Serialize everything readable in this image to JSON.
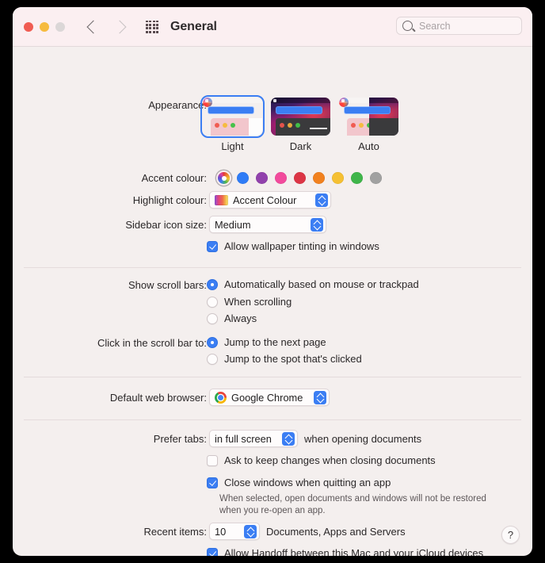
{
  "window": {
    "title": "General",
    "traffic_lights": [
      "close",
      "minimize",
      "zoom"
    ],
    "nav": {
      "back": "back-chevron",
      "forward": "forward-chevron",
      "grid": "show-all-grid-icon"
    }
  },
  "search": {
    "value": "",
    "placeholder": "Search",
    "icon": "search-icon"
  },
  "appearance": {
    "label": "Appearance:",
    "options": [
      {
        "name": "Light",
        "selected": true
      },
      {
        "name": "Dark",
        "selected": false
      },
      {
        "name": "Auto",
        "selected": false
      }
    ]
  },
  "accent_colour": {
    "label": "Accent colour:",
    "selected": "Multicolour",
    "swatches": [
      {
        "name": "Multicolour",
        "hex": "multi"
      },
      {
        "name": "Blue",
        "hex": "#2f7cf6"
      },
      {
        "name": "Purple",
        "hex": "#9141ac"
      },
      {
        "name": "Pink",
        "hex": "#f24a9c"
      },
      {
        "name": "Red",
        "hex": "#dc3545"
      },
      {
        "name": "Orange",
        "hex": "#f1811f"
      },
      {
        "name": "Yellow",
        "hex": "#f5c033"
      },
      {
        "name": "Green",
        "hex": "#3fb54a"
      },
      {
        "name": "Graphite",
        "hex": "#a1a1a1"
      }
    ]
  },
  "highlight_colour": {
    "label": "Highlight colour:",
    "value": "Accent Colour"
  },
  "sidebar_icon_size": {
    "label": "Sidebar icon size:",
    "value": "Medium"
  },
  "wallpaper_tinting": {
    "label": "Allow wallpaper tinting in windows",
    "checked": true
  },
  "scroll_bars": {
    "label": "Show scroll bars:",
    "options": [
      {
        "label": "Automatically based on mouse or trackpad",
        "selected": true
      },
      {
        "label": "When scrolling",
        "selected": false
      },
      {
        "label": "Always",
        "selected": false
      }
    ]
  },
  "scroll_bar_click": {
    "label": "Click in the scroll bar to:",
    "options": [
      {
        "label": "Jump to the next page",
        "selected": true
      },
      {
        "label": "Jump to the spot that's clicked",
        "selected": false
      }
    ]
  },
  "default_browser": {
    "label": "Default web browser:",
    "value": "Google Chrome",
    "icon": "chrome-icon"
  },
  "prefer_tabs": {
    "label": "Prefer tabs:",
    "value": "in full screen",
    "suffix": "when opening documents"
  },
  "ask_keep_changes": {
    "label": "Ask to keep changes when closing documents",
    "checked": false
  },
  "close_windows": {
    "label": "Close windows when quitting an app",
    "checked": true,
    "hint": "When selected, open documents and windows will not be restored when you re-open an app."
  },
  "recent_items": {
    "label": "Recent items:",
    "value": "10",
    "suffix": "Documents, Apps and Servers"
  },
  "handoff": {
    "label": "Allow Handoff between this Mac and your iCloud devices",
    "checked": true
  },
  "help": {
    "label": "?"
  }
}
